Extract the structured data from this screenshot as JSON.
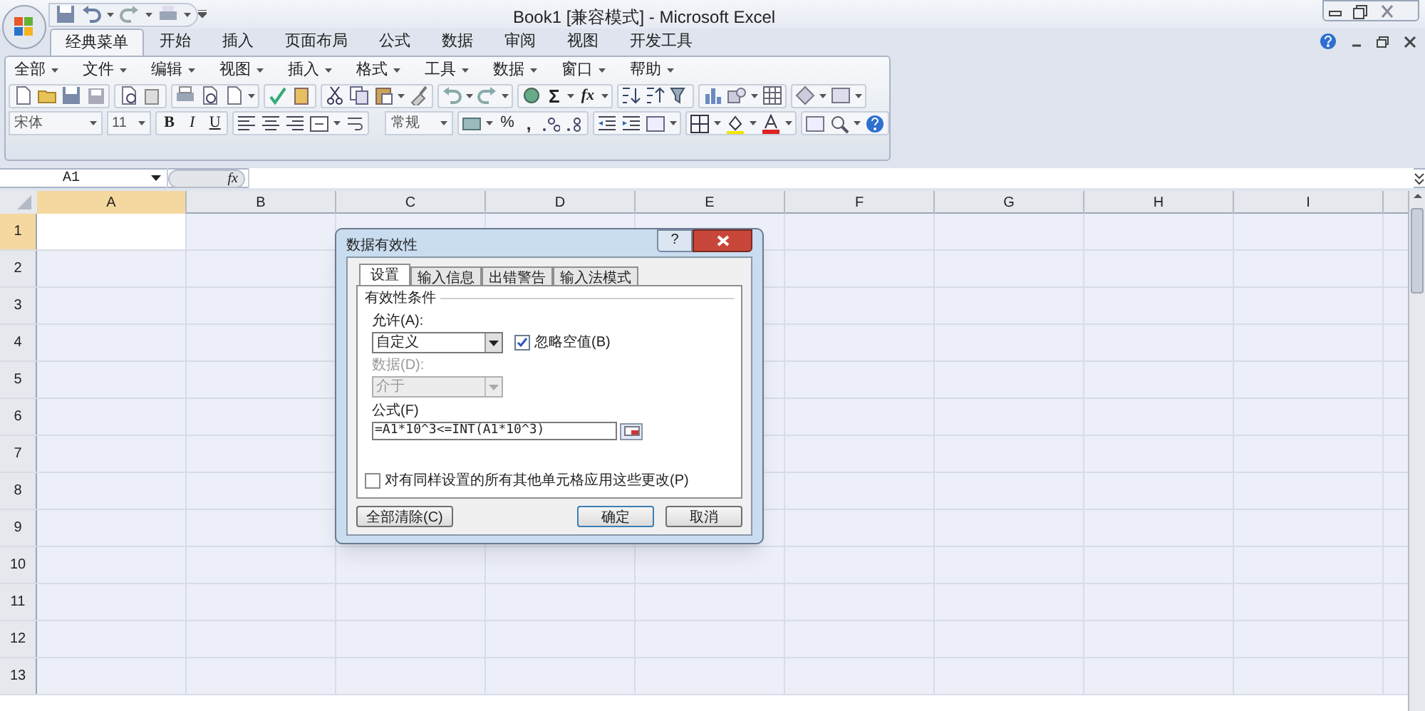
{
  "window": {
    "title": "Book1  [兼容模式] - Microsoft Excel"
  },
  "ribbon_tabs": [
    {
      "label": "经典菜单",
      "selected": true
    },
    {
      "label": "开始",
      "selected": false
    },
    {
      "label": "插入",
      "selected": false
    },
    {
      "label": "页面布局",
      "selected": false
    },
    {
      "label": "公式",
      "selected": false
    },
    {
      "label": "数据",
      "selected": false
    },
    {
      "label": "审阅",
      "selected": false
    },
    {
      "label": "视图",
      "selected": false
    },
    {
      "label": "开发工具",
      "selected": false
    }
  ],
  "classic_menus": [
    "全部",
    "文件",
    "编辑",
    "视图",
    "插入",
    "格式",
    "工具",
    "数据",
    "窗口",
    "帮助"
  ],
  "toolbar": {
    "sum": "Σ",
    "function": "fx",
    "font": "宋体",
    "size": "11",
    "bold": "B",
    "italic": "I",
    "underline": "U",
    "number_format": "常规",
    "percent": "%",
    "comma": ","
  },
  "formula_bar": {
    "name_box": "A1",
    "fx": "fx"
  },
  "columns": [
    {
      "label": "A",
      "selected": true
    },
    {
      "label": "B",
      "selected": false
    },
    {
      "label": "C",
      "selected": false
    },
    {
      "label": "D",
      "selected": false
    },
    {
      "label": "E",
      "selected": false
    },
    {
      "label": "F",
      "selected": false
    },
    {
      "label": "G",
      "selected": false
    },
    {
      "label": "H",
      "selected": false
    },
    {
      "label": "I",
      "selected": false
    }
  ],
  "rows": [
    {
      "label": "1",
      "selected": true
    },
    {
      "label": "2",
      "selected": false
    },
    {
      "label": "3",
      "selected": false
    },
    {
      "label": "4",
      "selected": false
    },
    {
      "label": "5",
      "selected": false
    },
    {
      "label": "6",
      "selected": false
    },
    {
      "label": "7",
      "selected": false
    },
    {
      "label": "8",
      "selected": false
    },
    {
      "label": "9",
      "selected": false
    },
    {
      "label": "10",
      "selected": false
    },
    {
      "label": "11",
      "selected": false
    },
    {
      "label": "12",
      "selected": false
    },
    {
      "label": "13",
      "selected": false
    }
  ],
  "dialog": {
    "title": "数据有效性",
    "help": "?",
    "tabs": [
      {
        "label": "设置",
        "selected": true
      },
      {
        "label": "输入信息",
        "selected": false
      },
      {
        "label": "出错警告",
        "selected": false
      },
      {
        "label": "输入法模式",
        "selected": false
      }
    ],
    "group_label": "有效性条件",
    "allow_label": "允许(A):",
    "allow_value": "自定义",
    "ignore_blank": {
      "label": "忽略空值(B)",
      "checked": true
    },
    "data_label": "数据(D):",
    "data_value": "介于",
    "data_disabled": true,
    "formula_label": "公式(F)",
    "formula_value": "=A1*10^3<=INT(A1*10^3)",
    "apply_all": {
      "label": "对有同样设置的所有其他单元格应用这些更改(P)",
      "checked": false
    },
    "buttons": [
      {
        "label": "全部清除(C)",
        "default": false
      },
      {
        "label": "确定",
        "default": true
      },
      {
        "label": "取消",
        "default": false
      }
    ]
  }
}
